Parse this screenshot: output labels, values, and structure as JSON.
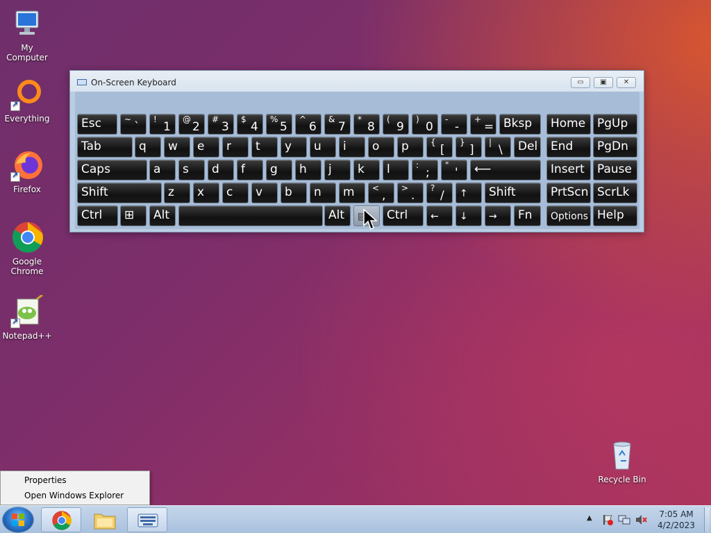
{
  "desktop": {
    "icons": [
      {
        "label": "My Computer",
        "icon": "computer-icon"
      },
      {
        "label": "Everything",
        "icon": "everything-icon"
      },
      {
        "label": "Firefox",
        "icon": "firefox-icon"
      },
      {
        "label": "Google Chrome",
        "label_line1": "Google",
        "label_line2": "Chrome",
        "icon": "chrome-icon"
      },
      {
        "label": "Notepad++",
        "icon": "notepadpp-icon"
      }
    ],
    "recycle_bin": {
      "label": "Recycle Bin",
      "icon": "recycle-bin-icon"
    }
  },
  "osk": {
    "title": "On-Screen Keyboard",
    "buttons": {
      "minimize": "▭",
      "restore": "▣",
      "close": "✕"
    },
    "keys": {
      "esc": "Esc",
      "tilde_shift": "~",
      "tilde": "`",
      "k1s": "!",
      "k1": "1",
      "k2s": "@",
      "k2": "2",
      "k3s": "#",
      "k3": "3",
      "k4s": "$",
      "k4": "4",
      "k5s": "%",
      "k5": "5",
      "k6s": "^",
      "k6": "6",
      "k7s": "&",
      "k7": "7",
      "k8s": "*",
      "k8": "8",
      "k9s": "(",
      "k9": "9",
      "k0s": ")",
      "k0": "0",
      "minus_s": "-",
      "minus": "-",
      "plus_s": "+",
      "equals": "=",
      "bksp": "Bksp",
      "home": "Home",
      "pgup": "PgUp",
      "tab": "Tab",
      "q": "q",
      "w": "w",
      "e": "e",
      "r": "r",
      "t": "t",
      "y": "y",
      "u": "u",
      "i": "i",
      "o": "o",
      "p": "p",
      "lbr_s": "{",
      "lbr": "[",
      "rbr_s": "}",
      "rbr": "]",
      "bsl_s": "|",
      "bsl": "\\",
      "del": "Del",
      "end": "End",
      "pgdn": "PgDn",
      "caps": "Caps",
      "a": "a",
      "s": "s",
      "d": "d",
      "f": "f",
      "g": "g",
      "h": "h",
      "j": "j",
      "k": "k",
      "l": "l",
      "semi_s": ":",
      "semi": ";",
      "quote_s": "\"",
      "quote": "'",
      "enter": "⟵",
      "insert": "Insert",
      "pause": "Pause",
      "shift": "Shift",
      "z": "z",
      "x": "x",
      "c": "c",
      "v": "v",
      "b": "b",
      "n": "n",
      "m": "m",
      "comma_s": "<",
      "comma": ",",
      "period_s": ">",
      "period": ".",
      "slash_s": "?",
      "slash": "/",
      "up": "↑",
      "shift_r": "Shift",
      "prtscn": "PrtScn",
      "scrlk": "ScrLk",
      "ctrl": "Ctrl",
      "win": "⊞",
      "alt": "Alt",
      "alt_r": "Alt",
      "menu": "▤",
      "ctrl_r": "Ctrl",
      "left": "←",
      "down": "↓",
      "right": "→",
      "fn": "Fn",
      "options": "Options",
      "help": "Help"
    }
  },
  "context_menu": {
    "items": [
      "Properties",
      "Open Windows Explorer"
    ]
  },
  "taskbar": {
    "apps": [
      "Google Chrome",
      "File Explorer",
      "On-Screen Keyboard"
    ],
    "clock": {
      "time": "7:05 AM",
      "date": "4/2/2023"
    },
    "tray_up": "▲"
  }
}
